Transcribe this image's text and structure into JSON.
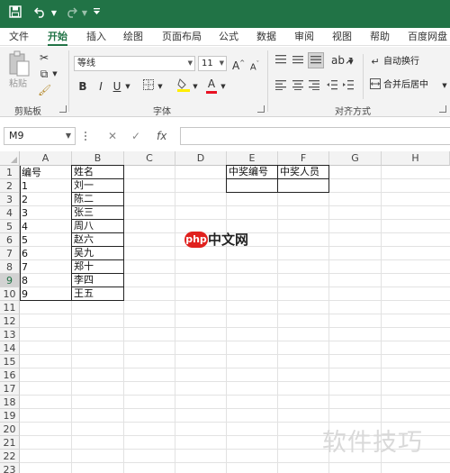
{
  "quick_access": {
    "save_icon": "save-icon",
    "undo_icon": "undo-icon",
    "redo_icon": "redo-icon"
  },
  "tabs": [
    "文件",
    "开始",
    "插入",
    "绘图",
    "页面布局",
    "公式",
    "数据",
    "审阅",
    "视图",
    "帮助",
    "百度网盘"
  ],
  "active_tab": "开始",
  "ribbon": {
    "clipboard": {
      "paste_label": "粘贴",
      "group_label": "剪贴板"
    },
    "font": {
      "font_name": "等线",
      "font_size": "11",
      "grow": "A",
      "shrink": "A",
      "bold": "B",
      "italic": "I",
      "underline": "U",
      "font_color_letter": "A",
      "group_label": "字体"
    },
    "alignment": {
      "wrap_text": "自动换行",
      "merge_center": "合并后居中",
      "group_label": "对齐方式"
    }
  },
  "formula_bar": {
    "name_box": "M9",
    "fx": "fx",
    "formula": ""
  },
  "columns": [
    "A",
    "B",
    "C",
    "D",
    "E",
    "F",
    "G",
    "H"
  ],
  "rows": [
    "1",
    "2",
    "3",
    "4",
    "5",
    "6",
    "7",
    "8",
    "9",
    "10",
    "11",
    "12",
    "13",
    "14",
    "15",
    "16",
    "17",
    "18",
    "19",
    "20",
    "21",
    "22",
    "23"
  ],
  "selected_row": "9",
  "sheet": {
    "header_a": "编号",
    "header_b": "姓名",
    "ids": [
      "1",
      "2",
      "3",
      "4",
      "5",
      "6",
      "7",
      "8",
      "9"
    ],
    "names": [
      "刘一",
      "陈二",
      "张三",
      "周八",
      "赵六",
      "吴九",
      "郑十",
      "李四",
      "王五"
    ],
    "header_e": "中奖编号",
    "header_f": "中奖人员"
  },
  "watermarks": {
    "center_brand": "php",
    "center_text": "中文网",
    "corner_text": "软件技巧"
  },
  "colors": {
    "accent": "#217346",
    "brand_red": "#e0211e"
  }
}
